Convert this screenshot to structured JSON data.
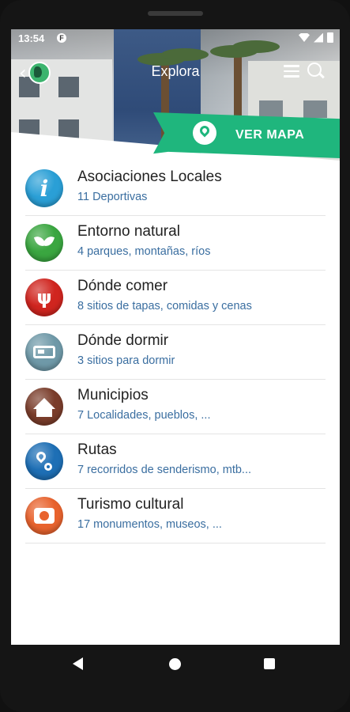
{
  "status_bar": {
    "time": "13:54",
    "notification_badge": "F"
  },
  "header": {
    "title": "Explora"
  },
  "map_button": {
    "label": "VER MAPA"
  },
  "categories": [
    {
      "name": "Asociaciones Locales",
      "sub": "11 Deportivas",
      "icon": "info-icon",
      "color": "#2a9fd6"
    },
    {
      "name": "Entorno natural",
      "sub": "4 parques, montañas, ríos",
      "icon": "leaf-icon",
      "color": "#3aa640"
    },
    {
      "name": "Dónde comer",
      "sub": "8 sitios de tapas, comidas y cenas",
      "icon": "cutlery-icon",
      "color": "#d0251f"
    },
    {
      "name": "Dónde dormir",
      "sub": "3 sitios para dormir",
      "icon": "bed-icon",
      "color": "#6f99a8"
    },
    {
      "name": "Municipios",
      "sub": "7 Localidades, pueblos, ...",
      "icon": "houses-icon",
      "color": "#7a3d2b"
    },
    {
      "name": "Rutas",
      "sub": "7 recorridos de senderismo, mtb...",
      "icon": "route-icon",
      "color": "#1e6fb5"
    },
    {
      "name": "Turismo cultural",
      "sub": "17 monumentos, museos, ...",
      "icon": "camera-icon",
      "color": "#e8632e"
    }
  ]
}
